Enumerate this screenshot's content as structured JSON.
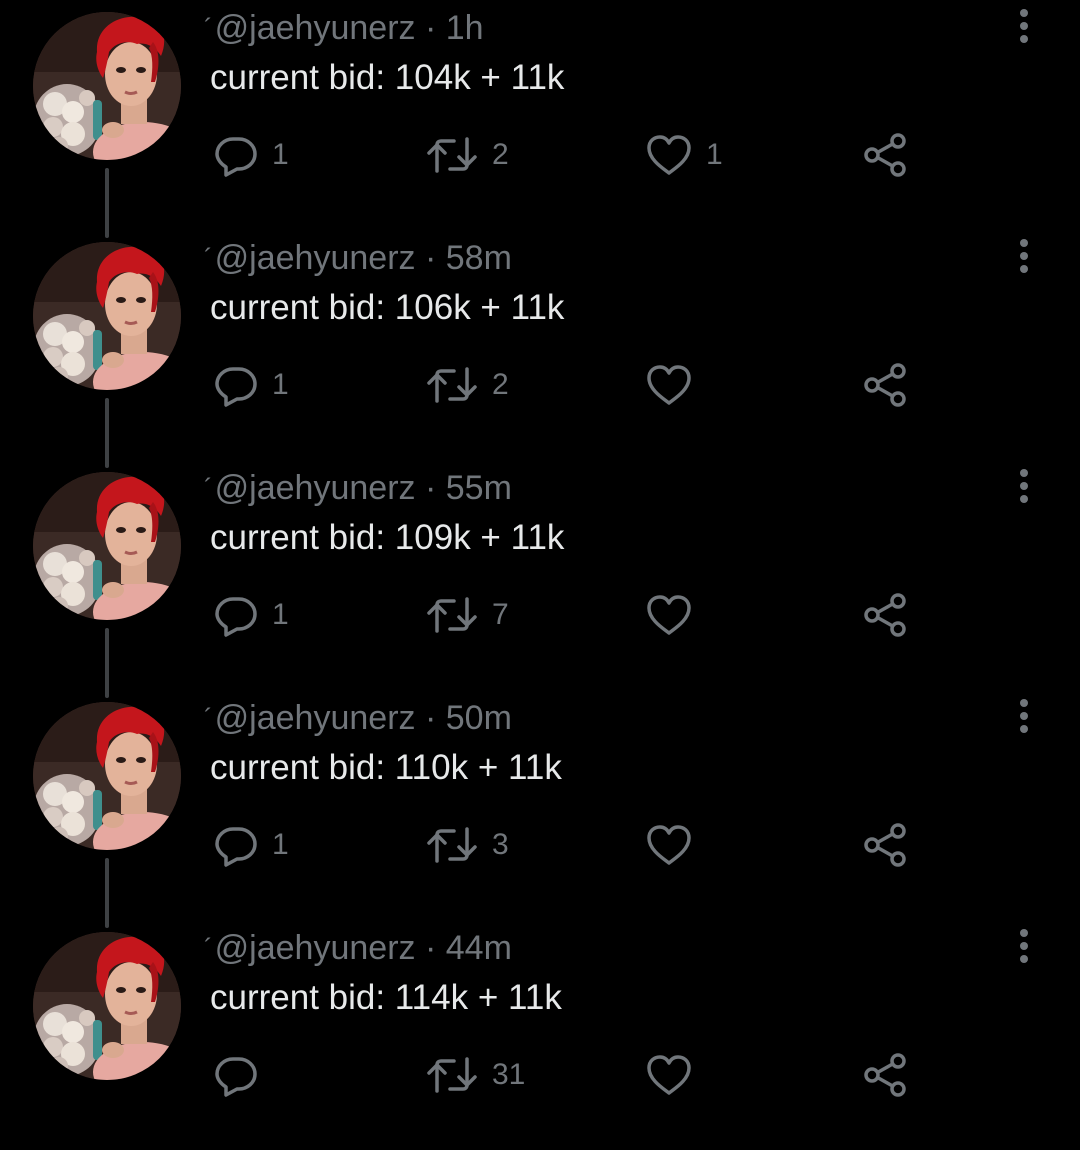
{
  "thread": {
    "tweets": [
      {
        "mark": "´",
        "handle": "@jaehyunerz",
        "separator": "·",
        "time": "1h",
        "text": "current bid: 104k + 11k",
        "replies": "1",
        "retweets": "2",
        "likes": "1"
      },
      {
        "mark": "´",
        "handle": "@jaehyunerz",
        "separator": "·",
        "time": "58m",
        "text": "current bid: 106k + 11k",
        "replies": "1",
        "retweets": "2",
        "likes": ""
      },
      {
        "mark": "´",
        "handle": "@jaehyunerz",
        "separator": "·",
        "time": "55m",
        "text": "current bid: 109k + 11k",
        "replies": "1",
        "retweets": "7",
        "likes": ""
      },
      {
        "mark": "´",
        "handle": "@jaehyunerz",
        "separator": "·",
        "time": "50m",
        "text": "current bid: 110k + 11k",
        "replies": "1",
        "retweets": "3",
        "likes": ""
      },
      {
        "mark": "´",
        "handle": "@jaehyunerz",
        "separator": "·",
        "time": "44m",
        "text": "current bid: 114k + 11k",
        "replies": "",
        "retweets": "31",
        "likes": ""
      }
    ]
  },
  "icons": {
    "reply": "reply-icon",
    "retweet": "retweet-icon",
    "like": "heart-icon",
    "share": "share-icon",
    "more": "more-vertical-icon",
    "avatar": "profile-photo-avatar"
  },
  "colors": {
    "background": "#000000",
    "text_primary": "#e7e9ea",
    "text_secondary": "#71767b",
    "thread_line": "#3e4144",
    "hair_red": "#c4161c"
  }
}
